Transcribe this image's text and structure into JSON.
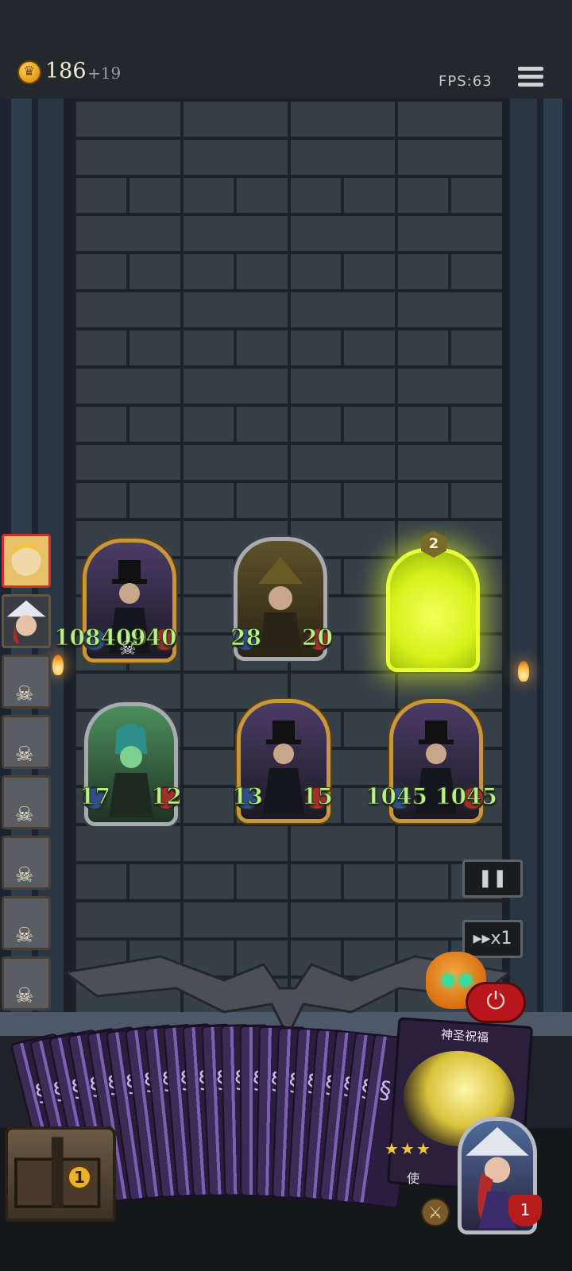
{
  "hud": {
    "gold": "186",
    "gold_income": "+19",
    "fps_label": "FPS:63"
  },
  "board": {
    "units": [
      {
        "id": "magician-1",
        "attack": "108400",
        "health": "940",
        "row": 1,
        "col": 1
      },
      {
        "id": "witch-hunter",
        "attack": "28",
        "health": "20",
        "row": 1,
        "col": 2
      },
      {
        "id": "summoning-slot",
        "level": "2",
        "row": 1,
        "col": 3
      },
      {
        "id": "elf-rogue",
        "attack": "17",
        "health": "12",
        "row": 2,
        "col": 1
      },
      {
        "id": "magician-2",
        "attack": "13",
        "health": "15",
        "row": 2,
        "col": 2
      },
      {
        "id": "magician-3",
        "attack": "1045",
        "health": "1045",
        "row": 2,
        "col": 3
      }
    ]
  },
  "roster": {
    "items": [
      {
        "name": "blonde-lady",
        "status": "active"
      },
      {
        "name": "witch-girl",
        "status": "ready"
      },
      {
        "name": "rabbit-beast",
        "status": "defeated"
      },
      {
        "name": "wolf-beast",
        "status": "defeated"
      },
      {
        "name": "stone-golem",
        "status": "defeated"
      },
      {
        "name": "hooded-woman",
        "status": "defeated"
      },
      {
        "name": "hat-rider",
        "status": "defeated"
      },
      {
        "name": "bat-knight",
        "status": "defeated"
      }
    ]
  },
  "controls": {
    "pause_label": "❚❚",
    "speed_label": "▸▸x1",
    "power_label": "⏻"
  },
  "hand": {
    "card_back_count": 20,
    "spell_title": "神圣祝福",
    "spell_stars": "★★★",
    "spell_desc_fragment": "使"
  },
  "footer": {
    "chest_badge": "1",
    "hero_lives": "1"
  },
  "colors": {
    "stat_green": "#b9f08a",
    "frame_gold": "#c8963c",
    "glow_yellow": "#e8ff3a",
    "danger_red": "#b8161b"
  }
}
